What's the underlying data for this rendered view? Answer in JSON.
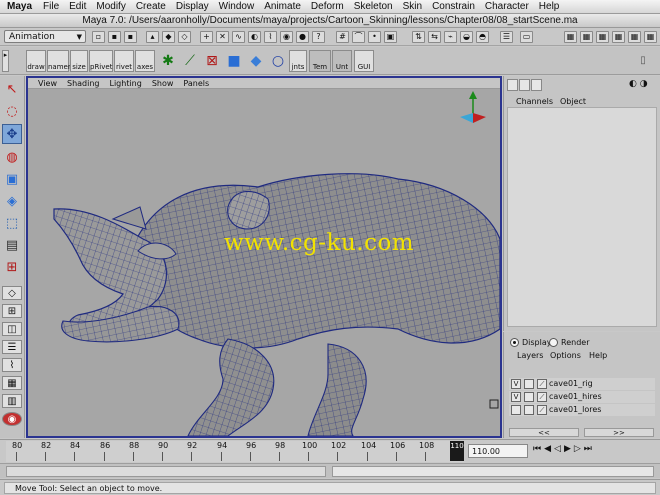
{
  "menubar": {
    "app": "Maya",
    "items": [
      "File",
      "Edit",
      "Modify",
      "Create",
      "Display",
      "Window",
      "Animate",
      "Deform",
      "Skeleton",
      "Skin",
      "Constrain",
      "Character",
      "Help"
    ]
  },
  "window": {
    "title": "Maya 7.0: /Users/aaronholly/Documents/maya/projects/Cartoon_Skinning/lessons/Chapter08/08_startScene.ma"
  },
  "statusline": {
    "mode": "Animation"
  },
  "shelf": {
    "left_buttons": [
      "draw",
      "namer",
      "size",
      "pRivet",
      "rivet",
      "axes"
    ],
    "right_buttons": [
      "jnts",
      "Tem",
      "Unt",
      "GUI"
    ]
  },
  "viewport": {
    "menu": [
      "View",
      "Shading",
      "Lighting",
      "Show",
      "Panels"
    ],
    "watermark": "www.cg-ku.com"
  },
  "channelbox": {
    "menu": [
      "Channels",
      "Object"
    ]
  },
  "layers": {
    "display_label": "Display",
    "render_label": "Render",
    "menu": [
      "Layers",
      "Options",
      "Help"
    ],
    "rows": [
      {
        "visible": "V",
        "name": "cave01_rig"
      },
      {
        "visible": "V",
        "name": "cave01_hires"
      },
      {
        "visible": "",
        "name": "cave01_lores"
      }
    ],
    "nav_prev": "<<",
    "nav_next": ">>"
  },
  "timeline": {
    "ticks": [
      "80",
      "82",
      "84",
      "86",
      "88",
      "90",
      "92",
      "94",
      "96",
      "98",
      "100",
      "102",
      "104",
      "106",
      "108"
    ],
    "current_frame_badge": "110",
    "current_frame_value": "110.00"
  },
  "helpline": {
    "text": "Move Tool: Select an object to move."
  },
  "colors": {
    "viewport_bg": "#a6a6a6",
    "viewport_border": "#2b3490",
    "wire": "#1f2a80",
    "watermark": "#f2e200",
    "active_tool": "#7fa7d9"
  }
}
